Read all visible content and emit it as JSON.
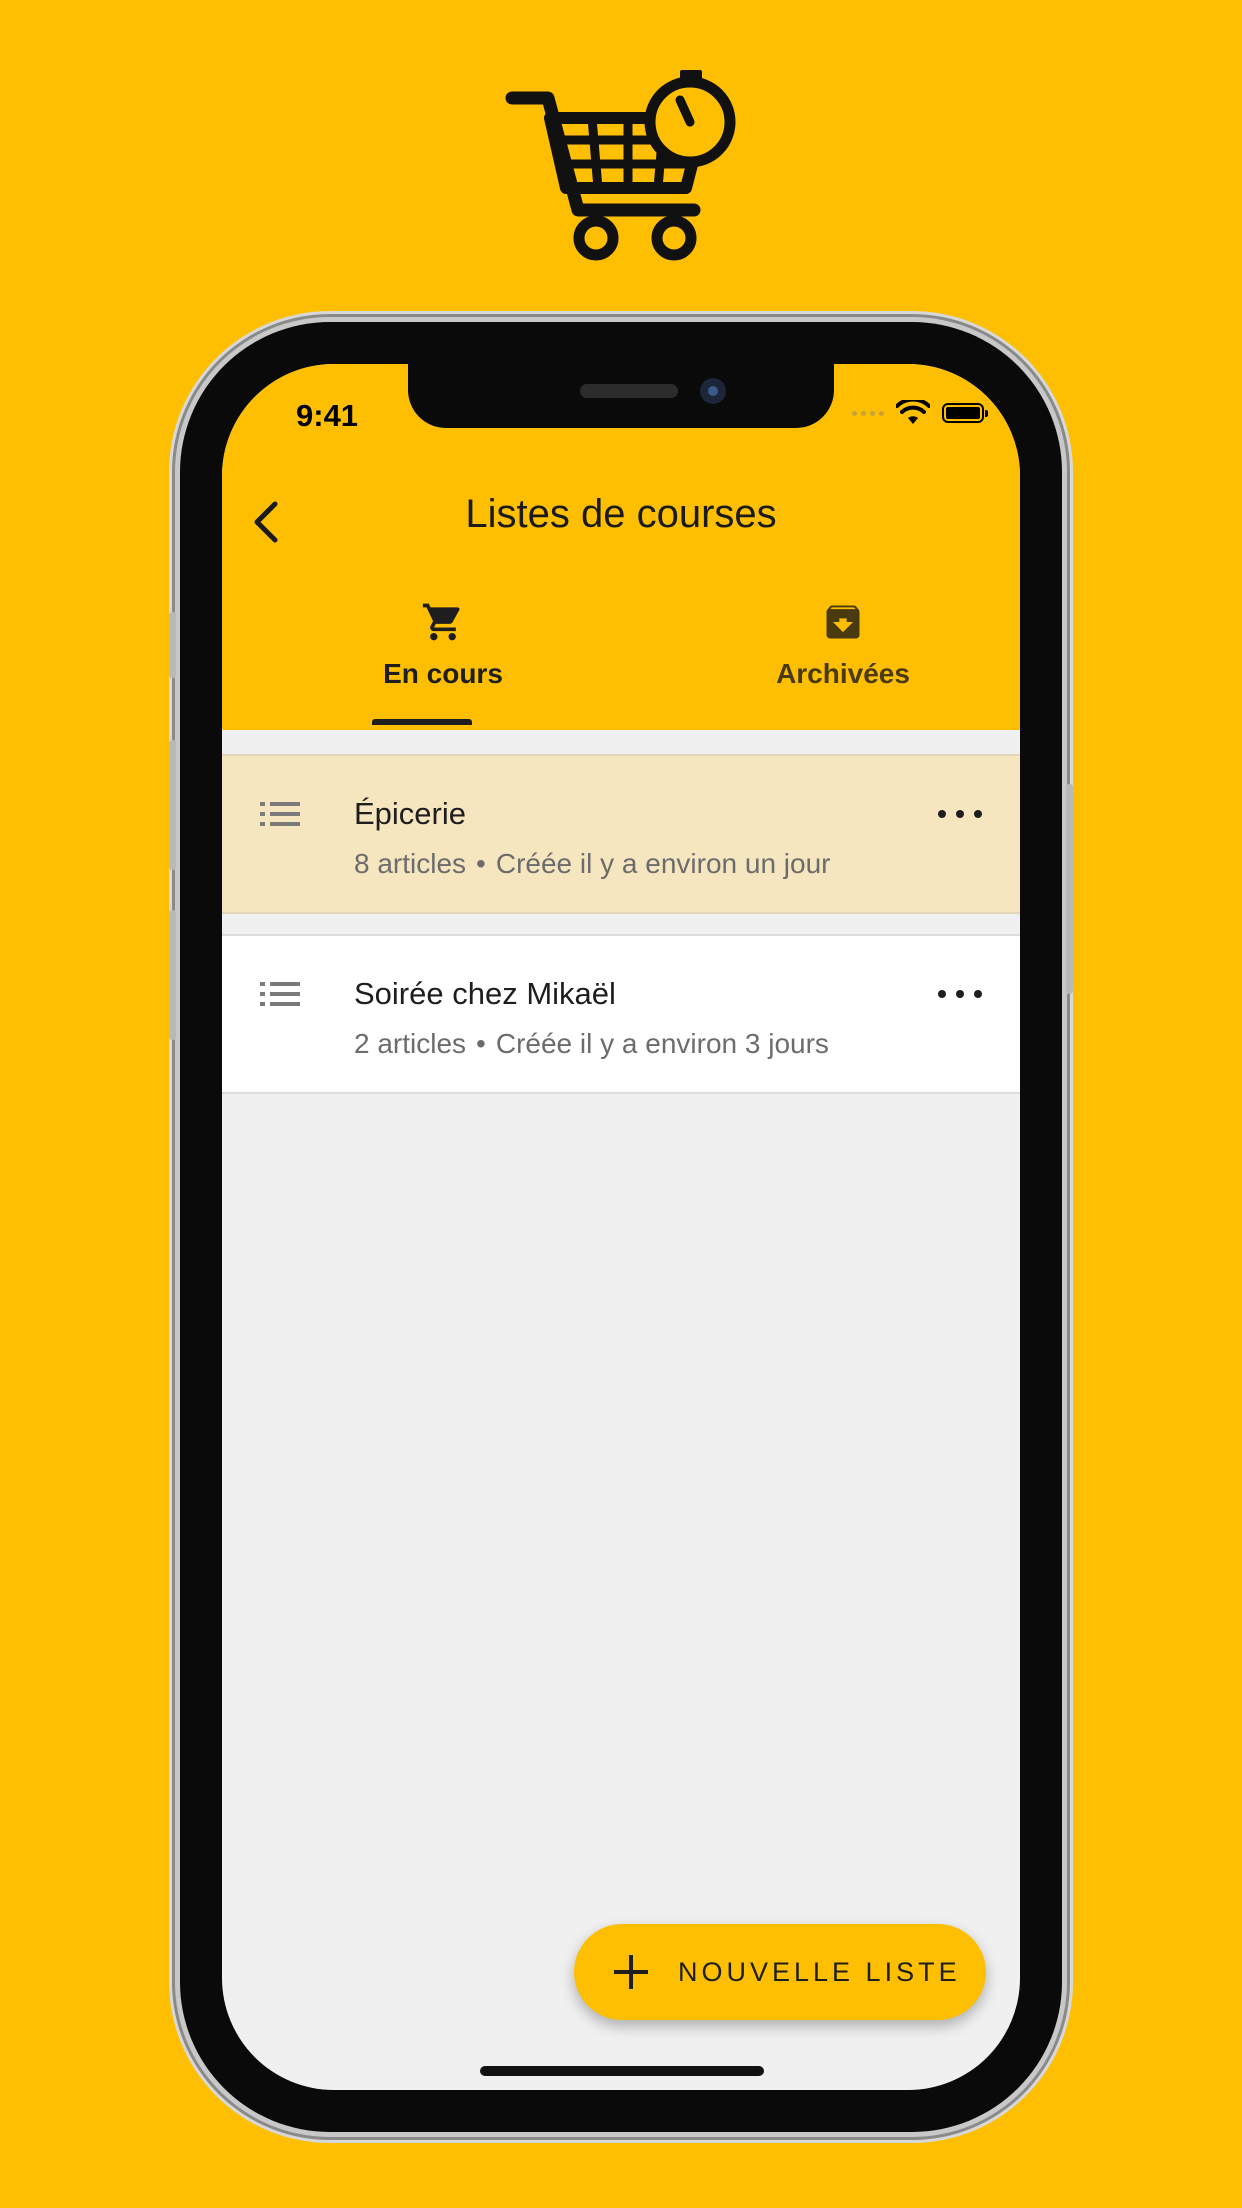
{
  "brand": {
    "logo_icon": "shopping-cart-timer-icon",
    "background_color": "#FEBF03",
    "accent_color": "#FEBF03",
    "selected_row_color": "#F5E6BF"
  },
  "status_bar": {
    "time": "9:41",
    "icons": [
      "signal-dots-icon",
      "wifi-icon",
      "battery-icon"
    ]
  },
  "header": {
    "back_icon": "chevron-left-icon",
    "title": "Listes de courses"
  },
  "tabs": [
    {
      "label": "En cours",
      "icon": "shopping-cart-icon",
      "active": true
    },
    {
      "label": "Archivées",
      "icon": "archive-icon",
      "active": false
    }
  ],
  "lists": [
    {
      "title": "Épicerie",
      "count": "8 articles",
      "separator": "•",
      "created": "Créée il y a environ un jour",
      "selected": true
    },
    {
      "title": "Soirée chez Mikaël",
      "count": "2 articles",
      "separator": "•",
      "created": "Créée il y a environ 3 jours",
      "selected": false
    }
  ],
  "fab": {
    "icon": "plus-icon",
    "label": "NOUVELLE LISTE"
  }
}
